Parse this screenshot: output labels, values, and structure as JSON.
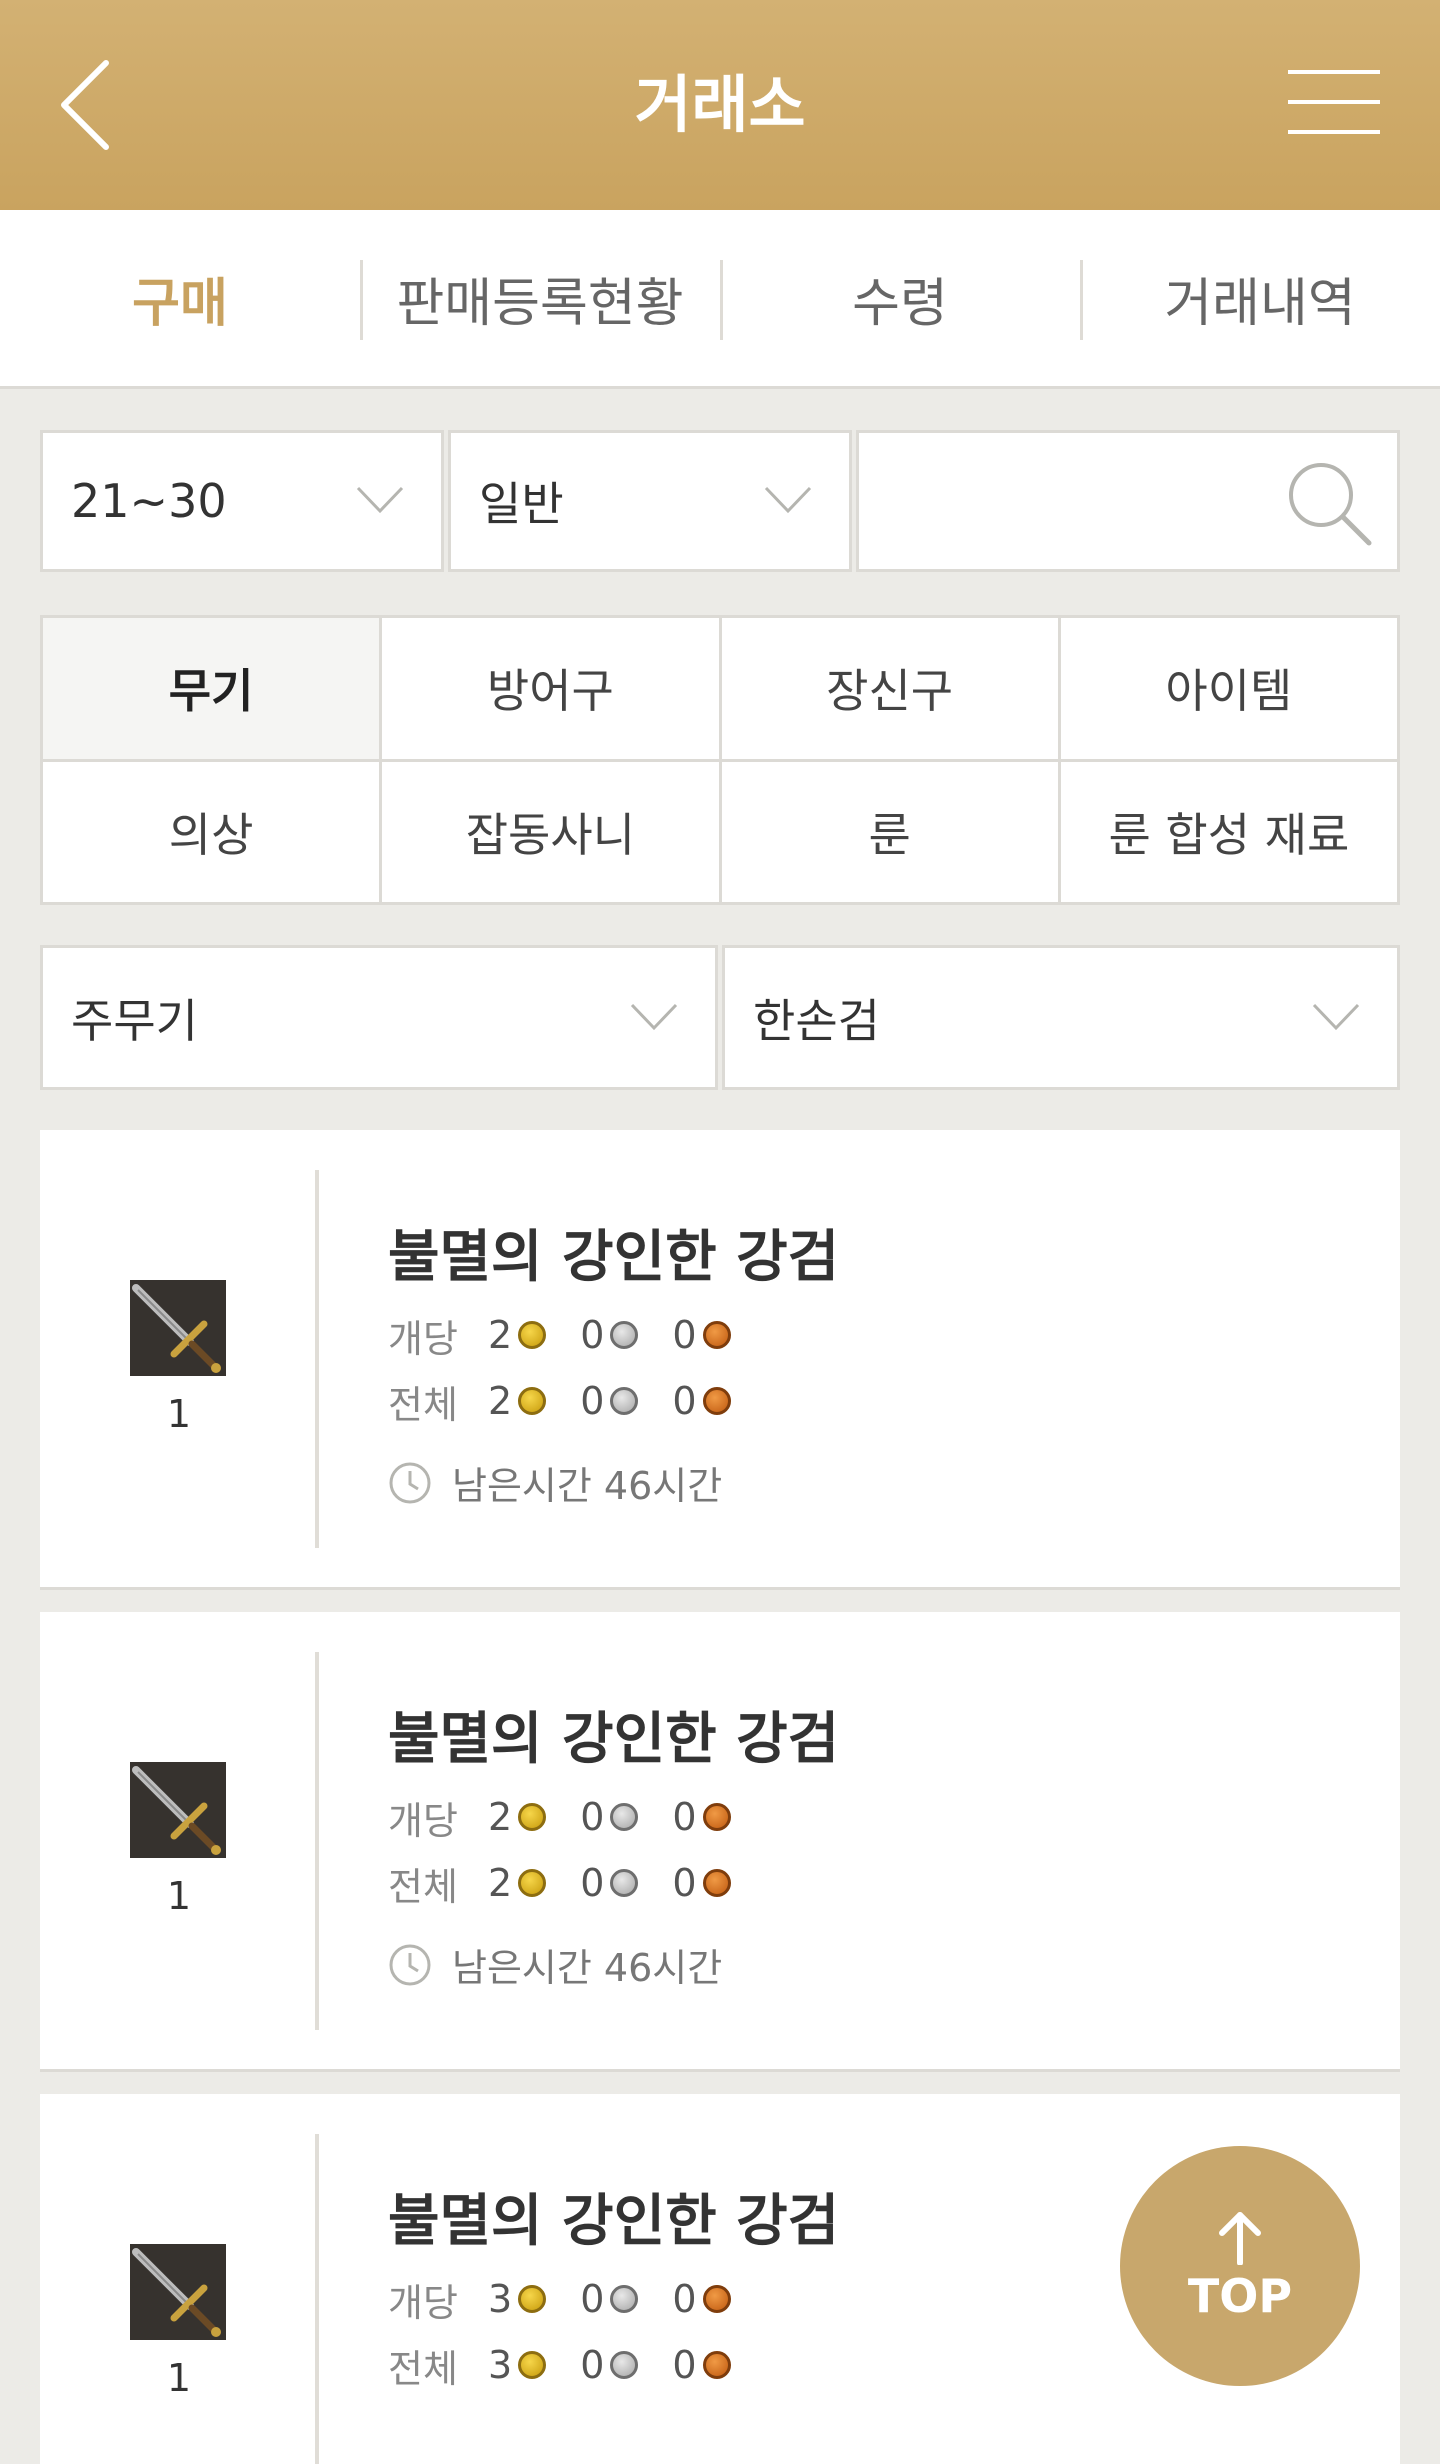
{
  "header": {
    "title": "거래소"
  },
  "tabs": [
    {
      "label": "구매",
      "active": true
    },
    {
      "label": "판매등록현황",
      "active": false
    },
    {
      "label": "수령",
      "active": false
    },
    {
      "label": "거래내역",
      "active": false
    }
  ],
  "filters": {
    "level": "21~30",
    "grade": "일반",
    "search_value": ""
  },
  "categories": [
    {
      "label": "무기",
      "active": true
    },
    {
      "label": "방어구"
    },
    {
      "label": "장신구"
    },
    {
      "label": "아이템"
    },
    {
      "label": "의상"
    },
    {
      "label": "잡동사니"
    },
    {
      "label": "룬"
    },
    {
      "label": "룬 합성 재료"
    }
  ],
  "subfilters": {
    "slot": "주무기",
    "type": "한손검"
  },
  "listings": [
    {
      "name": "불멸의 강인한 강검",
      "qty": "1",
      "unit_label": "개당",
      "unit_price": {
        "gold": "2",
        "silver": "0",
        "copper": "0"
      },
      "total_label": "전체",
      "total_price": {
        "gold": "2",
        "silver": "0",
        "copper": "0"
      },
      "remaining": "남은시간 46시간"
    },
    {
      "name": "불멸의 강인한 강검",
      "qty": "1",
      "unit_label": "개당",
      "unit_price": {
        "gold": "2",
        "silver": "0",
        "copper": "0"
      },
      "total_label": "전체",
      "total_price": {
        "gold": "2",
        "silver": "0",
        "copper": "0"
      },
      "remaining": "남은시간 46시간"
    },
    {
      "name": "불멸의 강인한 강검",
      "qty": "1",
      "unit_label": "개당",
      "unit_price": {
        "gold": "3",
        "silver": "0",
        "copper": "0"
      },
      "total_label": "전체",
      "total_price": {
        "gold": "3",
        "silver": "0",
        "copper": "0"
      },
      "remaining": ""
    }
  ],
  "top_button": {
    "label": "TOP"
  },
  "icons": {
    "back": "chevron-left-icon",
    "menu": "hamburger-menu-icon",
    "search": "search-icon",
    "dropdown": "chevron-down-icon",
    "clock": "clock-icon",
    "coins": [
      "gold-coin-icon",
      "silver-coin-icon",
      "copper-coin-icon"
    ],
    "top": "arrow-up-icon"
  },
  "colors": {
    "header": "#c9a35f",
    "accent": "#c8a260",
    "background": "#ecebe7"
  }
}
